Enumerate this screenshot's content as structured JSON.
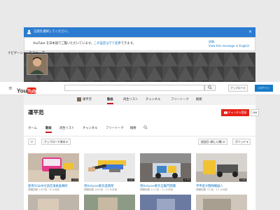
{
  "banner": {
    "heading": "言語を選択してください。",
    "message_prefix": "YouTube を日本語でご覧いただいています。",
    "message_link": "この設定は下で変更",
    "message_suffix": "できます。",
    "details_line1": "詳細",
    "details_line2": "View this message in English",
    "close": "×"
  },
  "skip_nav": "ナビゲーションをスキップ",
  "masthead": {
    "logo_text": "YouTube",
    "upload": "アップロード",
    "login": "ログイン"
  },
  "subnav": {
    "items": [
      {
        "label": "運平范",
        "active": false
      },
      {
        "label": "動画",
        "active": true
      },
      {
        "label": "再生リスト",
        "active": false
      },
      {
        "label": "チャンネル",
        "active": false
      },
      {
        "label": "フリートーク",
        "active": false
      },
      {
        "label": "概要",
        "active": false
      }
    ]
  },
  "channel": {
    "name": "運平范",
    "subscribe": "チャンネル登録",
    "subscriber_count": "164",
    "tabs": [
      "ホーム",
      "動画",
      "再生リスト",
      "チャンネル",
      "フリートーク",
      "概要"
    ],
    "active_tab": 1
  },
  "toolbar": {
    "back_icon": "↩",
    "uploads_dropdown": "アップロード済み ▾",
    "sort_dropdown": "追加日 (新しい順) ▾",
    "view_dropdown": "グリッド ▾"
  },
  "videos": [
    {
      "title": "使用5G&中文語音演員會舞時",
      "meta": "視聴回数 143 回・6 か月前",
      "duration": "1:24"
    },
    {
      "title": "用Arduino製作遊戲琴",
      "meta": "視聴回数 205 回・11 か月前",
      "duration": "1:47"
    },
    {
      "title": "用Arduino製作自動門開關",
      "meta": "視聴回数 111 回・11 か月前",
      "duration": "2:53"
    },
    {
      "title": "平甲星大戰陣機器人",
      "meta": "視聴回数 75 回・11 か月前",
      "duration": "0:45"
    }
  ],
  "colors": {
    "banner_blue": "#2b7bd1",
    "youtube_red": "#e62117",
    "link_blue": "#167ac6",
    "login_blue": "#167ac6"
  }
}
